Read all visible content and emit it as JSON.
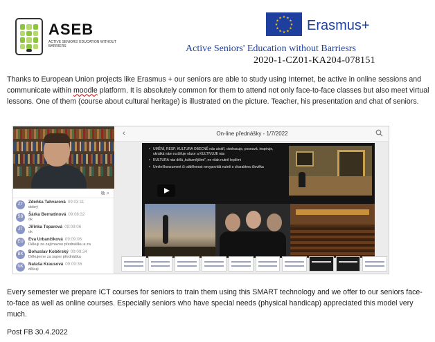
{
  "header": {
    "aseb_title": "ASEB",
    "aseb_subtitle": "Active Seniors' Education without Barriers",
    "erasmus_label": "Erasmus+",
    "project_title": "Active Seniors' Education without Barriesrs",
    "project_code": "2020-1-CZ01-KA204-078151"
  },
  "intro": {
    "part1": "Thanks to European Union projects like Erasmus + our seniors are able to study using Internet, be active in online sessions and communicate within ",
    "moodle": "moodle",
    "part2": " platform. It is absolutely common for them to attend not only face-to-face classes but also meet virtual lessons. One of them (course about cultural heritage) is illustrated on the picture. Teacher, his presentation and chat of seniors."
  },
  "screenshot": {
    "viewer_title": "On-line přednášky - 1/7/2022",
    "back_glyph": "‹",
    "chat_tools": "⧉ ⌕",
    "chat": [
      {
        "initials": "ZT",
        "name": "Zdeňka Tahvarová",
        "time": "09:03:11",
        "msg": "dobrý"
      },
      {
        "initials": "ŠB",
        "name": "Šárka Bernatínová",
        "time": "09:08:32",
        "msg": "ok"
      },
      {
        "initials": "JT",
        "name": "Jiřinka Toparová",
        "time": "09:09:06",
        "msg": "ok"
      },
      {
        "initials": "EU",
        "name": "Eva Urbančíková",
        "time": "09:09:06",
        "msg": "Děkuji za zajímavou přednášku a za"
      },
      {
        "initials": "BK",
        "name": "Bohuslav Koběrský",
        "time": "09:09:34",
        "msg": "Děkujeme za super přednášku"
      },
      {
        "initials": "NK",
        "name": "Nataša Krausová",
        "time": "09:09:36",
        "msg": "děkuji"
      }
    ],
    "slide_bullets": [
      "UMĚNÍ, RESP. KULTURA OBECNĚ nás utváří, obohacuje, posouvá, inspiruje, ukrátká nám rozšiřuje obzor a KULTIVUJE nás",
      "KULTURA nás dělá „kulturnějšími“, ne však nutně lepšími",
      "Umění/konzument či oddělenost nevypovídá nutně o charakteru člověka"
    ]
  },
  "outro": "Every semester we prepare ICT courses for seniors to train them using this SMART technology and we offer to our seniors face-to-face as well as online courses. Especially seniors who have special needs (physical handicap) appreciated this model very much.",
  "post": "Post FB 30.4.2022",
  "colors": {
    "eu_blue": "#1f3f9f",
    "eu_star": "#ffcc00",
    "aseb_green": "#8cc63f"
  }
}
